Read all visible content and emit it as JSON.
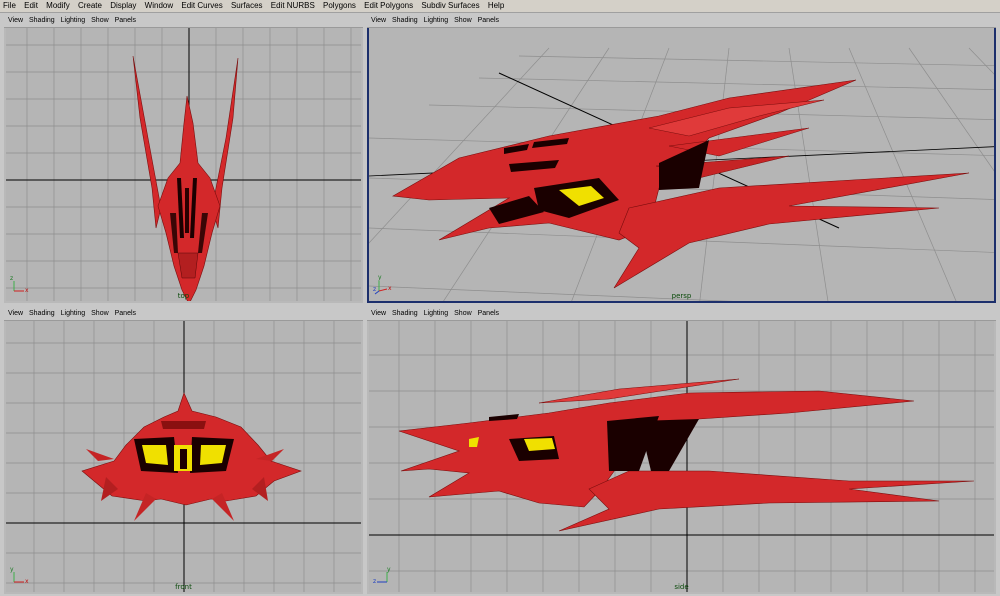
{
  "menubar": {
    "items": [
      "File",
      "Edit",
      "Modify",
      "Create",
      "Display",
      "Window",
      "Edit Curves",
      "Surfaces",
      "Edit NURBS",
      "Polygons",
      "Edit Polygons",
      "Subdiv Surfaces",
      "Help"
    ]
  },
  "panel_menu": {
    "items": [
      "View",
      "Shading",
      "Lighting",
      "Show",
      "Panels"
    ]
  },
  "viewports": {
    "top": {
      "label": "top"
    },
    "persp": {
      "label": "persp"
    },
    "front": {
      "label": "front"
    },
    "side": {
      "label": "side"
    }
  },
  "axes": {
    "x": "x",
    "y": "y",
    "z": "z"
  },
  "colors": {
    "grid": "#8f8f8f",
    "axis_line": "#000000",
    "model_red": "#d3282a",
    "model_dark": "#1a0000",
    "glass": "#f0e000",
    "active_border": "#1c2f6c"
  }
}
